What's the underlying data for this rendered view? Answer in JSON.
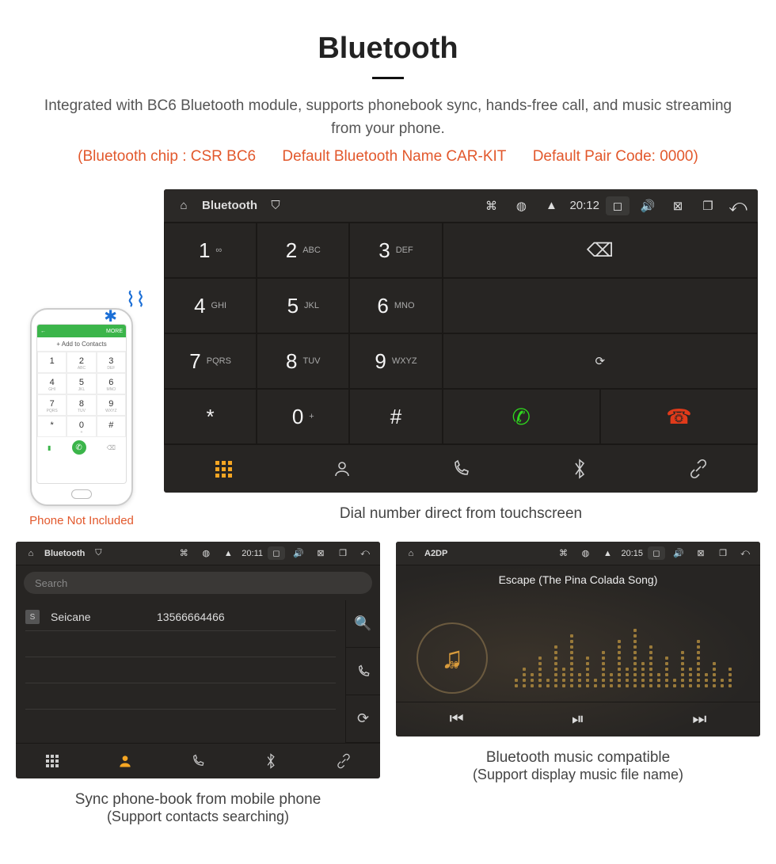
{
  "header": {
    "title": "Bluetooth",
    "description": "Integrated with BC6 Bluetooth module, supports phonebook sync, hands-free call, and music streaming from your phone.",
    "specs": {
      "chip": "(Bluetooth chip : CSR BC6",
      "name": "Default Bluetooth Name CAR-KIT",
      "code": "Default Pair Code: 0000)"
    }
  },
  "phone": {
    "top_more": "MORE",
    "add_contacts": "+ Add to Contacts",
    "not_included": "Phone Not Included",
    "keys": [
      {
        "d": "1",
        "s": ""
      },
      {
        "d": "2",
        "s": "ABC"
      },
      {
        "d": "3",
        "s": "DEF"
      },
      {
        "d": "4",
        "s": "GHI"
      },
      {
        "d": "5",
        "s": "JKL"
      },
      {
        "d": "6",
        "s": "MNO"
      },
      {
        "d": "7",
        "s": "PQRS"
      },
      {
        "d": "8",
        "s": "TUV"
      },
      {
        "d": "9",
        "s": "WXYZ"
      },
      {
        "d": "*",
        "s": ""
      },
      {
        "d": "0",
        "s": "+"
      },
      {
        "d": "#",
        "s": ""
      }
    ]
  },
  "dialer": {
    "statusbar": {
      "title": "Bluetooth",
      "time": "20:12"
    },
    "keys": [
      {
        "n": "1",
        "s": "∞"
      },
      {
        "n": "2",
        "s": "ABC"
      },
      {
        "n": "3",
        "s": "DEF"
      },
      {
        "n": "4",
        "s": "GHI"
      },
      {
        "n": "5",
        "s": "JKL"
      },
      {
        "n": "6",
        "s": "MNO"
      },
      {
        "n": "7",
        "s": "PQRS"
      },
      {
        "n": "8",
        "s": "TUV"
      },
      {
        "n": "9",
        "s": "WXYZ"
      },
      {
        "n": "*",
        "s": ""
      },
      {
        "n": "0",
        "s": "+"
      },
      {
        "n": "#",
        "s": ""
      }
    ],
    "caption": "Dial number direct from touchscreen"
  },
  "contacts": {
    "statusbar": {
      "title": "Bluetooth",
      "time": "20:11"
    },
    "search_placeholder": "Search",
    "items": [
      {
        "badge": "S",
        "name": "Seicane",
        "number": "13566664466"
      }
    ],
    "caption_line1": "Sync phone-book from mobile phone",
    "caption_line2": "(Support contacts searching)"
  },
  "music": {
    "statusbar": {
      "title": "A2DP",
      "time": "20:15"
    },
    "track": "Escape (The Pina Colada Song)",
    "caption_line1": "Bluetooth music compatible",
    "caption_line2": "(Support display music file name)",
    "bars": [
      2,
      4,
      3,
      6,
      2,
      8,
      4,
      10,
      3,
      6,
      2,
      7,
      3,
      9,
      4,
      11,
      5,
      8,
      3,
      6,
      2,
      7,
      4,
      9,
      3,
      5,
      2,
      4
    ]
  }
}
